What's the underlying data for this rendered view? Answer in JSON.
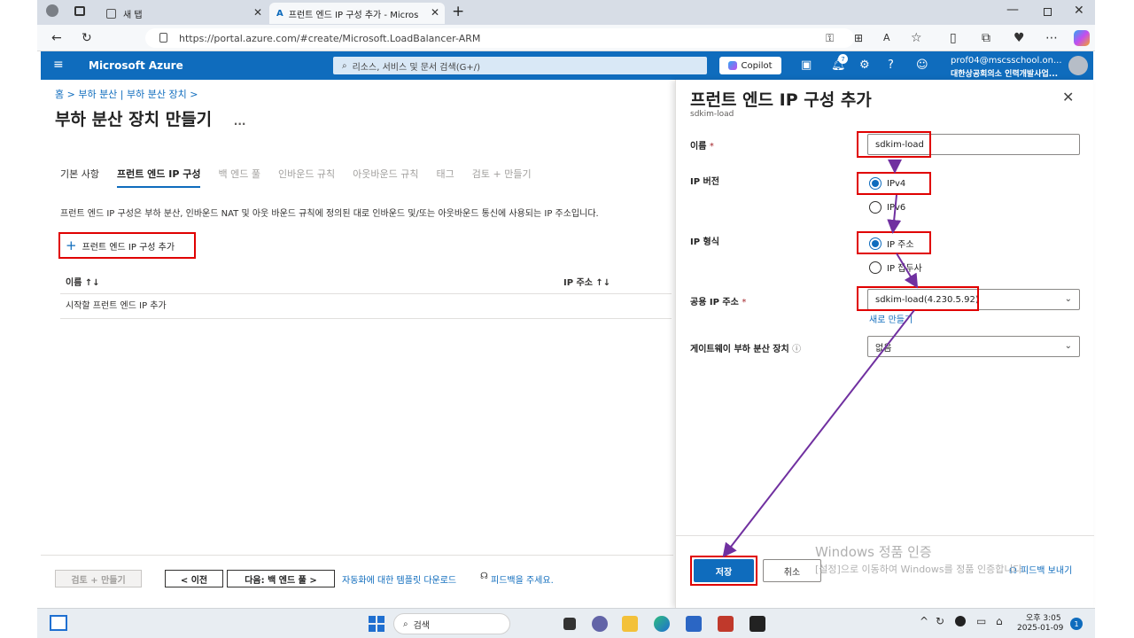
{
  "browser": {
    "tab_inactive": "새 탭",
    "tab_active": "프런트 엔드 IP 구성 추가 - Micros",
    "url": "https://portal.azure.com/#create/Microsoft.LoadBalancer-ARM"
  },
  "header": {
    "brand": "Microsoft Azure",
    "search_placeholder": "리소스, 서비스 및 문서 검색(G+/)",
    "copilot": "Copilot",
    "notif_count": "7",
    "user_email": "prof04@mscsschool.on...",
    "user_org": "대한상공회의소 인력개발사업..."
  },
  "page": {
    "breadcrumb": "홈  >  부하 분산 | 부하 분산 장치  >",
    "title": "부하 분산 장치 만들기",
    "title_more": "...",
    "tabs": [
      "기본 사항",
      "프런트 엔드 IP 구성",
      "백 엔드 풀",
      "인바운드 규칙",
      "아웃바운드 규칙",
      "태그",
      "검토 + 만들기"
    ],
    "description": "프런트 엔드 IP 구성은 부하 분산, 인바운드 NAT 및 아웃 바운드 규칙에 정의된 대로 인바운드 및/또는 아웃바운드 통신에 사용되는 IP 주소입니다.",
    "add_button": "프런트 엔드 IP 구성 추가",
    "table": {
      "col_name": "이름 ↑↓",
      "col_ip": "IP 주소 ↑↓",
      "empty_row": "시작할 프런트 엔드 IP 추가"
    },
    "footer": {
      "review": "검토 + 만들기",
      "prev": "< 이전",
      "next": "다음: 백 엔드 풀 >",
      "template_link": "자동화에 대한 템플릿 다운로드",
      "feedback": "피드백을 주세요."
    }
  },
  "panel": {
    "title": "프런트 엔드 IP 구성 추가",
    "subtitle": "sdkim-load",
    "name_label": "이름",
    "name_value": "sdkim-load",
    "ipver_label": "IP 버전",
    "ipver_opt1": "IPv4",
    "ipver_opt2": "IPv6",
    "iptype_label": "IP 형식",
    "iptype_opt1": "IP 주소",
    "iptype_opt2": "IP 접두사",
    "pubip_label": "공용 IP 주소",
    "pubip_value": "sdkim-load(4.230.5.92)",
    "create_new": "새로 만들기",
    "gw_label": "게이트웨이 부하 분산 장치",
    "gw_value": "없음",
    "save": "저장",
    "cancel": "취소",
    "feedback": "피드백 보내기"
  },
  "watermark": {
    "line1": "Windows 정품 인증",
    "line2": "[설정]으로 이동하여 Windows를 정품 인증합니다."
  },
  "taskbar": {
    "search": "검색",
    "time": "오후 3:05",
    "date": "2025-01-09",
    "badge": "1"
  },
  "colors": {
    "azure_blue": "#0f6cbd",
    "highlight_red": "#e00000",
    "arrow_purple": "#7030a0"
  }
}
